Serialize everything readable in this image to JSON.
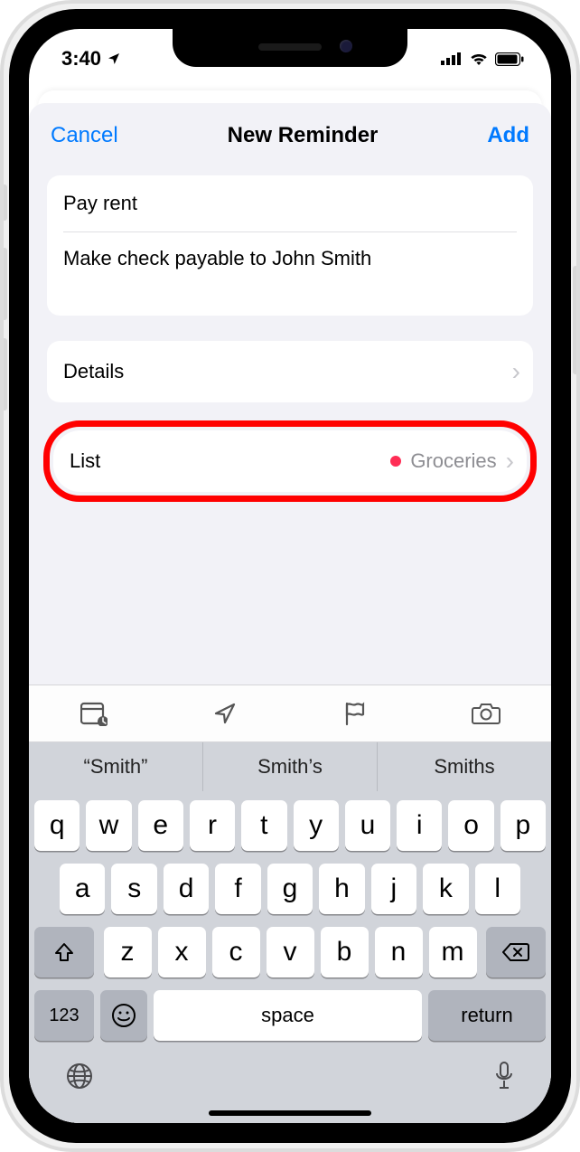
{
  "status": {
    "time": "3:40",
    "location_services": true
  },
  "nav": {
    "cancel": "Cancel",
    "title": "New Reminder",
    "add": "Add"
  },
  "reminder": {
    "title": "Pay rent",
    "notes": "Make check payable to John Smith"
  },
  "details": {
    "label": "Details"
  },
  "list": {
    "label": "List",
    "value": "Groceries",
    "color": "#ff2d55"
  },
  "predictive": {
    "s1": "“Smith”",
    "s2": "Smith’s",
    "s3": "Smiths"
  },
  "keyboard": {
    "row1": [
      "q",
      "w",
      "e",
      "r",
      "t",
      "y",
      "u",
      "i",
      "o",
      "p"
    ],
    "row2": [
      "a",
      "s",
      "d",
      "f",
      "g",
      "h",
      "j",
      "k",
      "l"
    ],
    "row3": [
      "z",
      "x",
      "c",
      "v",
      "b",
      "n",
      "m"
    ],
    "num": "123",
    "space": "space",
    "return": "return"
  }
}
